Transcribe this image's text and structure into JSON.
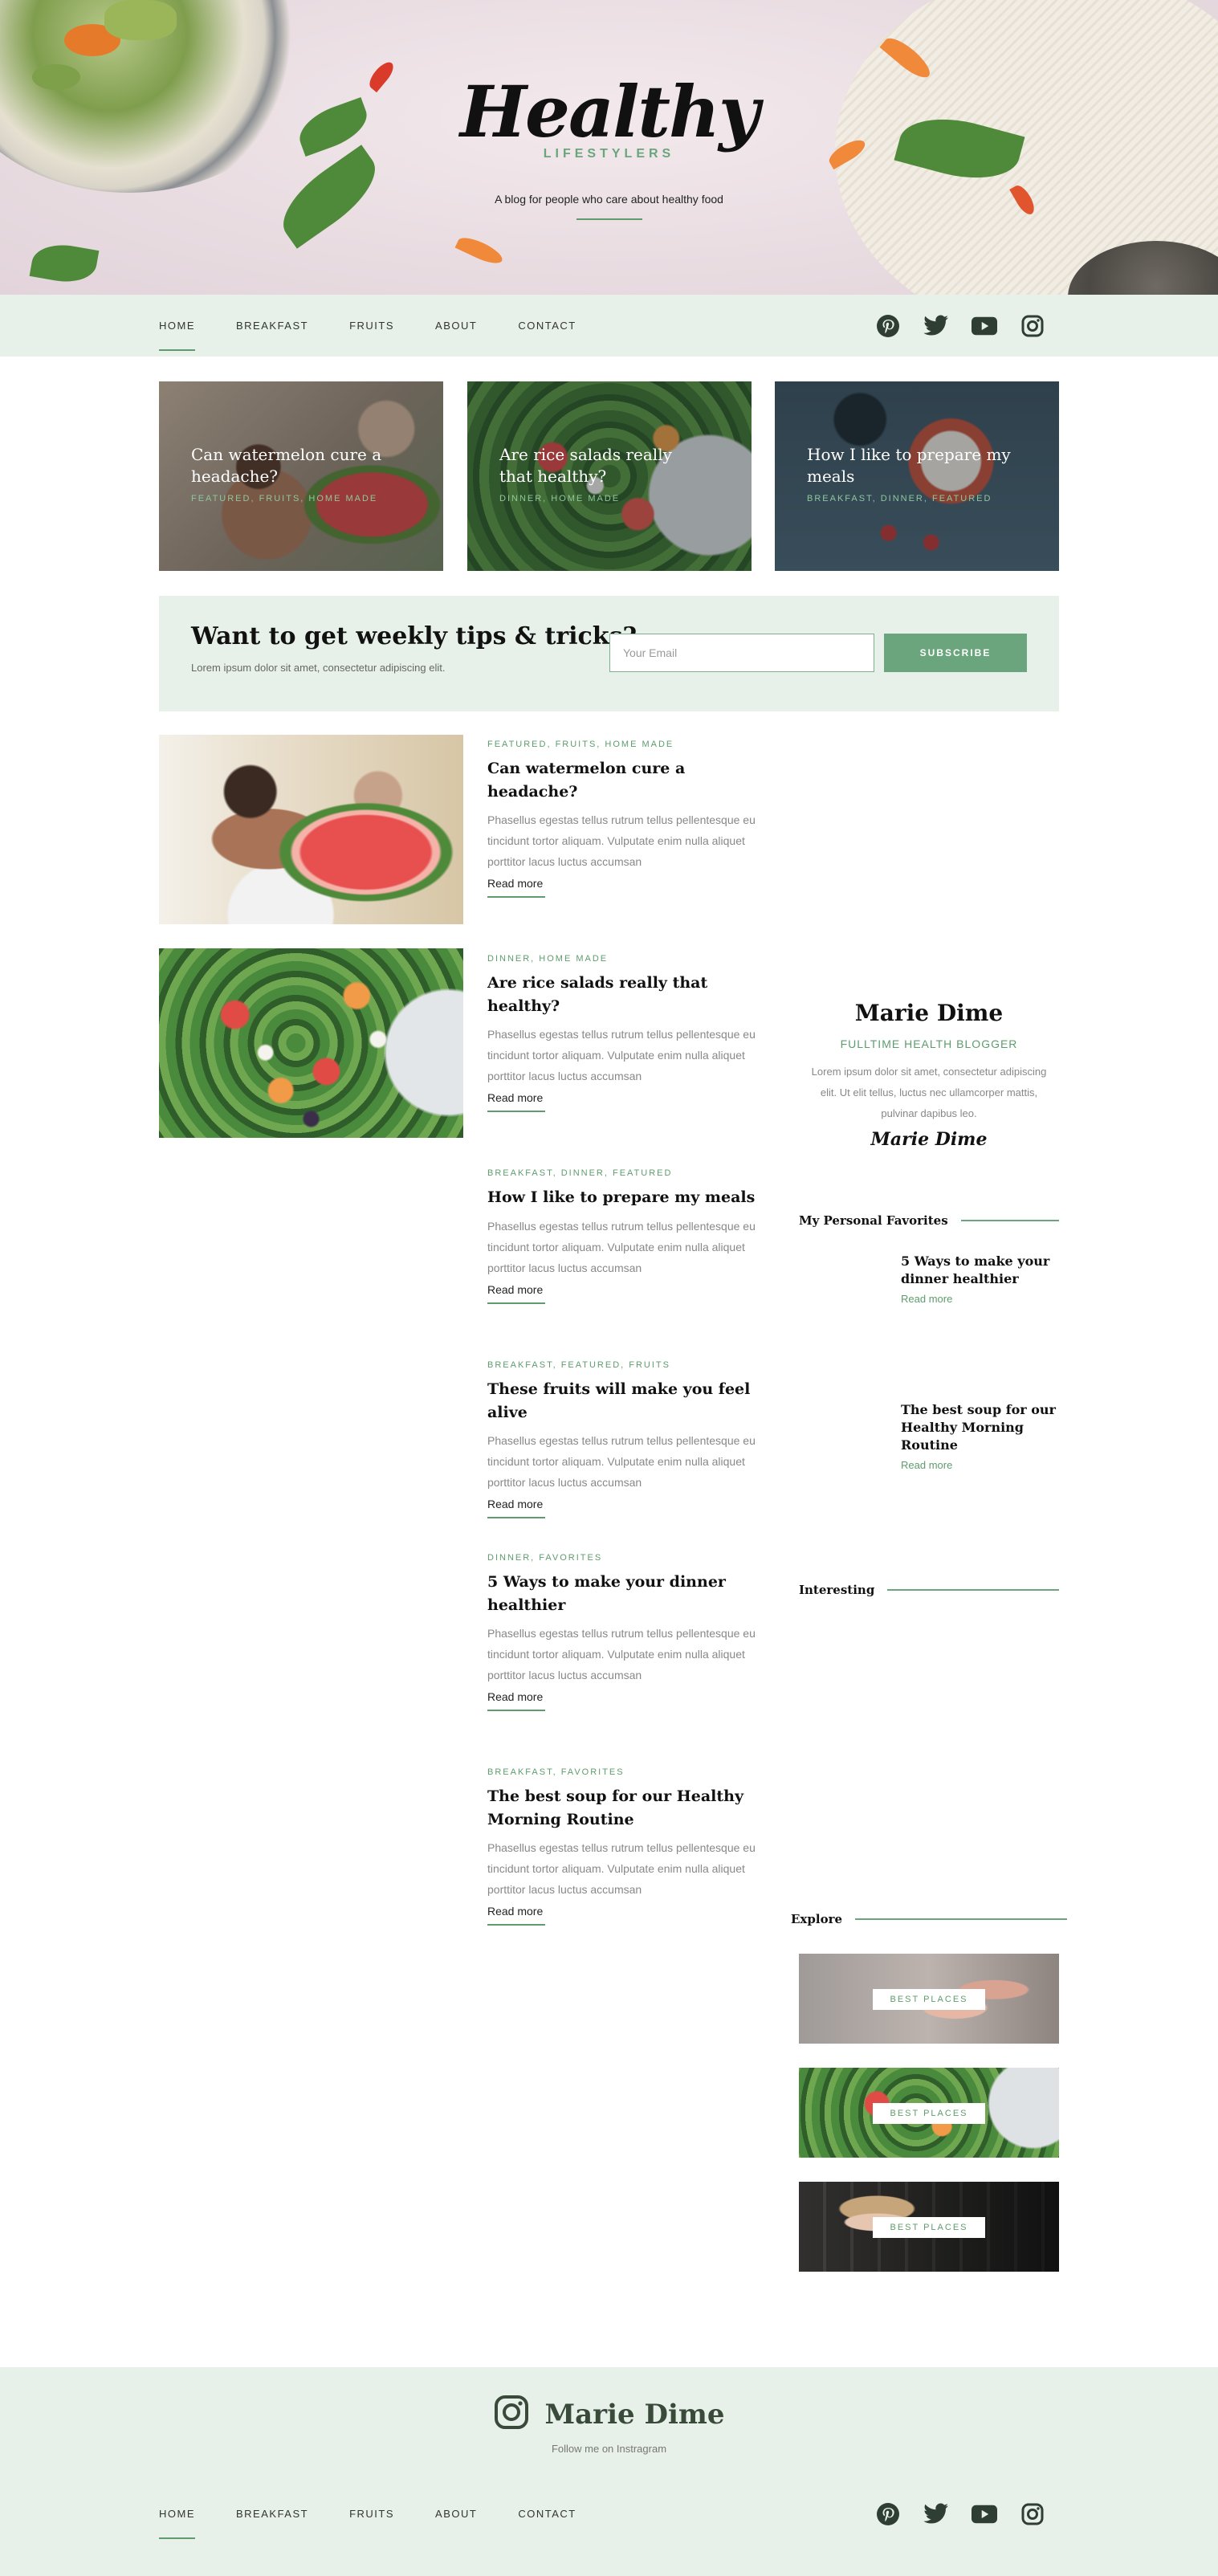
{
  "hero": {
    "logo_script": "Healthy",
    "logo_sub": "LIFESTYLERS",
    "tagline": "A blog for people who care about healthy food"
  },
  "nav": {
    "items": [
      {
        "label": "HOME",
        "active": true
      },
      {
        "label": "BREAKFAST",
        "active": false
      },
      {
        "label": "FRUITS",
        "active": false
      },
      {
        "label": "ABOUT",
        "active": false
      },
      {
        "label": "CONTACT",
        "active": false
      }
    ],
    "social": [
      "pinterest-icon",
      "twitter-icon",
      "youtube-icon",
      "instagram-icon"
    ]
  },
  "featured": [
    {
      "title": "Can watermelon cure a headache?",
      "cats": "FEATURED, FRUITS, HOME MADE"
    },
    {
      "title": "Are rice salads really that healthy?",
      "cats": "DINNER, HOME MADE"
    },
    {
      "title": "How I like to prepare my meals",
      "cats": "BREAKFAST, DINNER, FEATURED"
    }
  ],
  "newsletter": {
    "title": "Want to get weekly tips & tricks?",
    "text": "Lorem ipsum dolor sit amet, consectetur adipiscing elit.",
    "placeholder": "Your Email",
    "button": "SUBSCRIBE"
  },
  "posts": [
    {
      "cats": "FEATURED, FRUITS, HOME MADE",
      "title": "Can watermelon cure a headache?",
      "excerpt": "Phasellus egestas tellus rutrum tellus pellentesque eu tincidunt tortor aliquam. Vulputate enim nulla aliquet porttitor lacus luctus accumsan",
      "readmore": "Read more"
    },
    {
      "cats": "DINNER, HOME MADE",
      "title": "Are rice salads really that healthy?",
      "excerpt": "Phasellus egestas tellus rutrum tellus pellentesque eu tincidunt tortor aliquam. Vulputate enim nulla aliquet porttitor lacus luctus accumsan",
      "readmore": "Read more"
    },
    {
      "cats": "BREAKFAST, DINNER, FEATURED",
      "title": "How I like to prepare my meals",
      "excerpt": "Phasellus egestas tellus rutrum tellus pellentesque eu tincidunt tortor aliquam. Vulputate enim nulla aliquet porttitor lacus luctus accumsan",
      "readmore": "Read more"
    },
    {
      "cats": "BREAKFAST, FEATURED, FRUITS",
      "title": "These fruits will make you feel alive",
      "excerpt": "Phasellus egestas tellus rutrum tellus pellentesque eu tincidunt tortor aliquam. Vulputate enim nulla aliquet porttitor lacus luctus accumsan",
      "readmore": "Read more"
    },
    {
      "cats": "DINNER, FAVORITES",
      "title": "5 Ways to make your dinner healthier",
      "excerpt": "Phasellus egestas tellus rutrum tellus pellentesque eu tincidunt tortor aliquam. Vulputate enim nulla aliquet porttitor lacus luctus accumsan",
      "readmore": "Read more"
    },
    {
      "cats": "BREAKFAST, FAVORITES",
      "title": "The best soup for our Healthy Morning Routine",
      "excerpt": "Phasellus egestas tellus rutrum tellus pellentesque eu tincidunt tortor aliquam. Vulputate enim nulla aliquet porttitor lacus luctus accumsan",
      "readmore": "Read more"
    }
  ],
  "sidebar": {
    "author": {
      "name": "Marie Dime",
      "role": "FULLTIME HEALTH BLOGGER",
      "bio": "Lorem ipsum dolor sit amet, consectetur adipiscing elit. Ut elit tellus, luctus nec ullamcorper mattis, pulvinar dapibus leo.",
      "signature": "Marie Dime"
    },
    "favorites_heading": "My Personal Favorites",
    "favorites": [
      {
        "title": "5 Ways to make your dinner healthier",
        "readmore": "Read more"
      },
      {
        "title": "The best soup for our Healthy Morning Routine",
        "readmore": "Read more"
      }
    ],
    "interesting_heading": "Interesting",
    "explore_heading": "Explore",
    "explore": [
      {
        "label": "BEST PLACES"
      },
      {
        "label": "BEST PLACES"
      },
      {
        "label": "BEST PLACES"
      }
    ]
  },
  "footer": {
    "name": "Marie Dime",
    "follow": "Follow me on Instragram"
  },
  "colors": {
    "accent": "#5e9c6d",
    "mint_bg": "#e8f1e9",
    "icon": "#2f3e33"
  }
}
